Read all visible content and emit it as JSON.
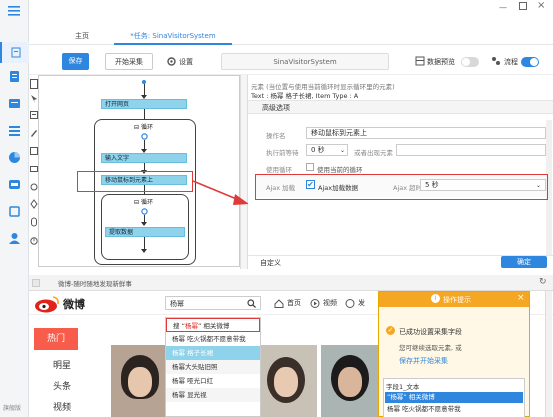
{
  "colors": {
    "brand": "#2e86de",
    "accent": "#f5a623",
    "flow_step": "#8fd2ec",
    "highlight": "#e03b3b",
    "weibo_red": "#e2231a"
  },
  "tabs": {
    "home": "主页",
    "task": "*任务: SinaVisitorSystem"
  },
  "toolbar": {
    "save": "保存",
    "start": "开始采集",
    "settings": "设置",
    "task_name": "SinaVisitorSystem",
    "data_preview": "数据预览",
    "flow": "流程"
  },
  "flow": {
    "open_page": "打开网页",
    "loop1": "循环",
    "input_text": "输入文字",
    "move_mouse": "移动鼠标到元素上",
    "loop2": "循环",
    "extract": "提取数据"
  },
  "props": {
    "element_line": "元素 (当位置与使用当前循环时显示循环里的元素)",
    "text_line": "Text : 杨幂 格子长裙, Item Type : A",
    "advanced": "高级选项",
    "op_name_label": "操作名",
    "op_name_value": "移动鼠标到元素上",
    "before_label": "执行前等待",
    "before_value": "0 秒",
    "or_label": "或者出现元素",
    "use_loop_label": "使用循环",
    "use_loop_check": "使用当前的循环",
    "ajax_label": "Ajax 加载",
    "ajax_check": "Ajax加载数据",
    "ajax_timeout_label": "Ajax 超时",
    "ajax_timeout_value": "5 秒",
    "custom": "自定义",
    "confirm": "确定"
  },
  "browser": {
    "url": "微博-随时随地发现新鲜事"
  },
  "weibo": {
    "logo": "微博",
    "search_value": "杨幂",
    "nav_home": "首页",
    "nav_video": "视频",
    "nav_discover": "发",
    "hot": "热门",
    "side": [
      "明星",
      "头条",
      "视频"
    ],
    "dropdown": [
      {
        "pre": "搜 “",
        "kw": "杨幂",
        "post": "” 相关微博"
      },
      {
        "text": "杨幂 吃火锅都不愿意带我"
      },
      {
        "text": "杨幂 格子长裙"
      },
      {
        "text": "杨幂大头贴旧照"
      },
      {
        "text": "杨幂 哑光口红"
      },
      {
        "text": "杨幂 显光视"
      }
    ]
  },
  "tip": {
    "title": "操作提示",
    "msg": "已成功设置采集字段",
    "sub": "您可继续选取元素, 或",
    "link": "保存并开始采集",
    "field": "字段1_文本",
    "rows": [
      "“杨幂” 相关微博",
      "杨幂 吃火锅都不愿意带我"
    ]
  },
  "rail_bottom": "旗舰版"
}
